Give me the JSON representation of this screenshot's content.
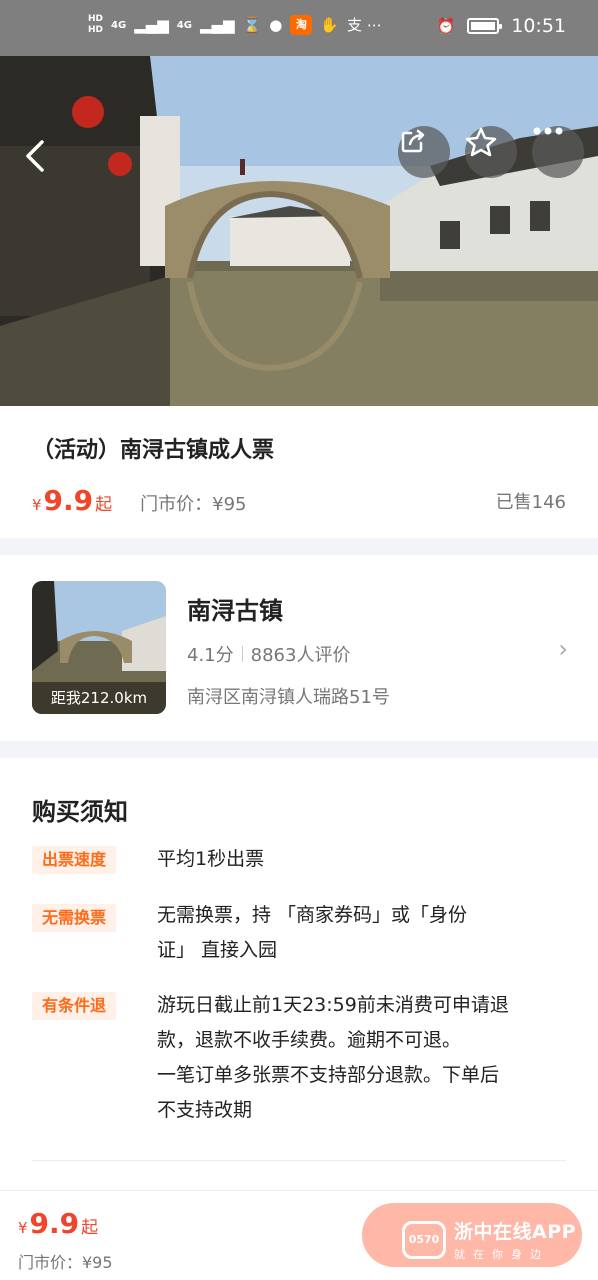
{
  "status_bar": {
    "hd1": "HD",
    "hd2": "HD",
    "net1": "4G",
    "net2": "4G",
    "app_badge": "淘",
    "misc": "支 ⋯",
    "time": "10:51"
  },
  "hero": {
    "back_icon": "back-arrow-icon",
    "share_icon": "share-icon",
    "favorite_icon": "star-icon",
    "more_icon": "more-icon"
  },
  "product": {
    "title": "（活动）南浔古镇成人票",
    "currency": "¥",
    "price": "9.9",
    "price_suffix": "起",
    "market_price": "门市价：¥95",
    "sold": "已售146"
  },
  "shop": {
    "name": "南浔古镇",
    "score": "4.1分",
    "reviews": "8863人评价",
    "address": "南浔区南浔镇人瑞路51号",
    "distance": "距我212.0km"
  },
  "notice": {
    "title": "购买须知",
    "items": [
      {
        "tag": "出票速度",
        "text": "平均1秒出票"
      },
      {
        "tag": "无需换票",
        "text": "无需换票，持 「商家券码」或「身份\n证」 直接入园"
      },
      {
        "tag": "有条件退",
        "text": "游玩日截止前1天23:59前未消费可申请退\n款，退款不收手续费。逾期不可退。\n一笔订单多张票不支持部分退款。下单后\n不支持改期"
      }
    ]
  },
  "bottom_bar": {
    "currency": "¥",
    "price": "9.9",
    "price_suffix": "起",
    "market_price": "门市价：¥95"
  },
  "watermark": {
    "logo": "0570",
    "main": "浙中在线APP",
    "sub": "就在你身边"
  },
  "colors": {
    "accent": "#f0442b",
    "tag_text": "#ff6a1a",
    "tag_bg": "#fff1e8",
    "buy_button": "#ffb7a8"
  }
}
